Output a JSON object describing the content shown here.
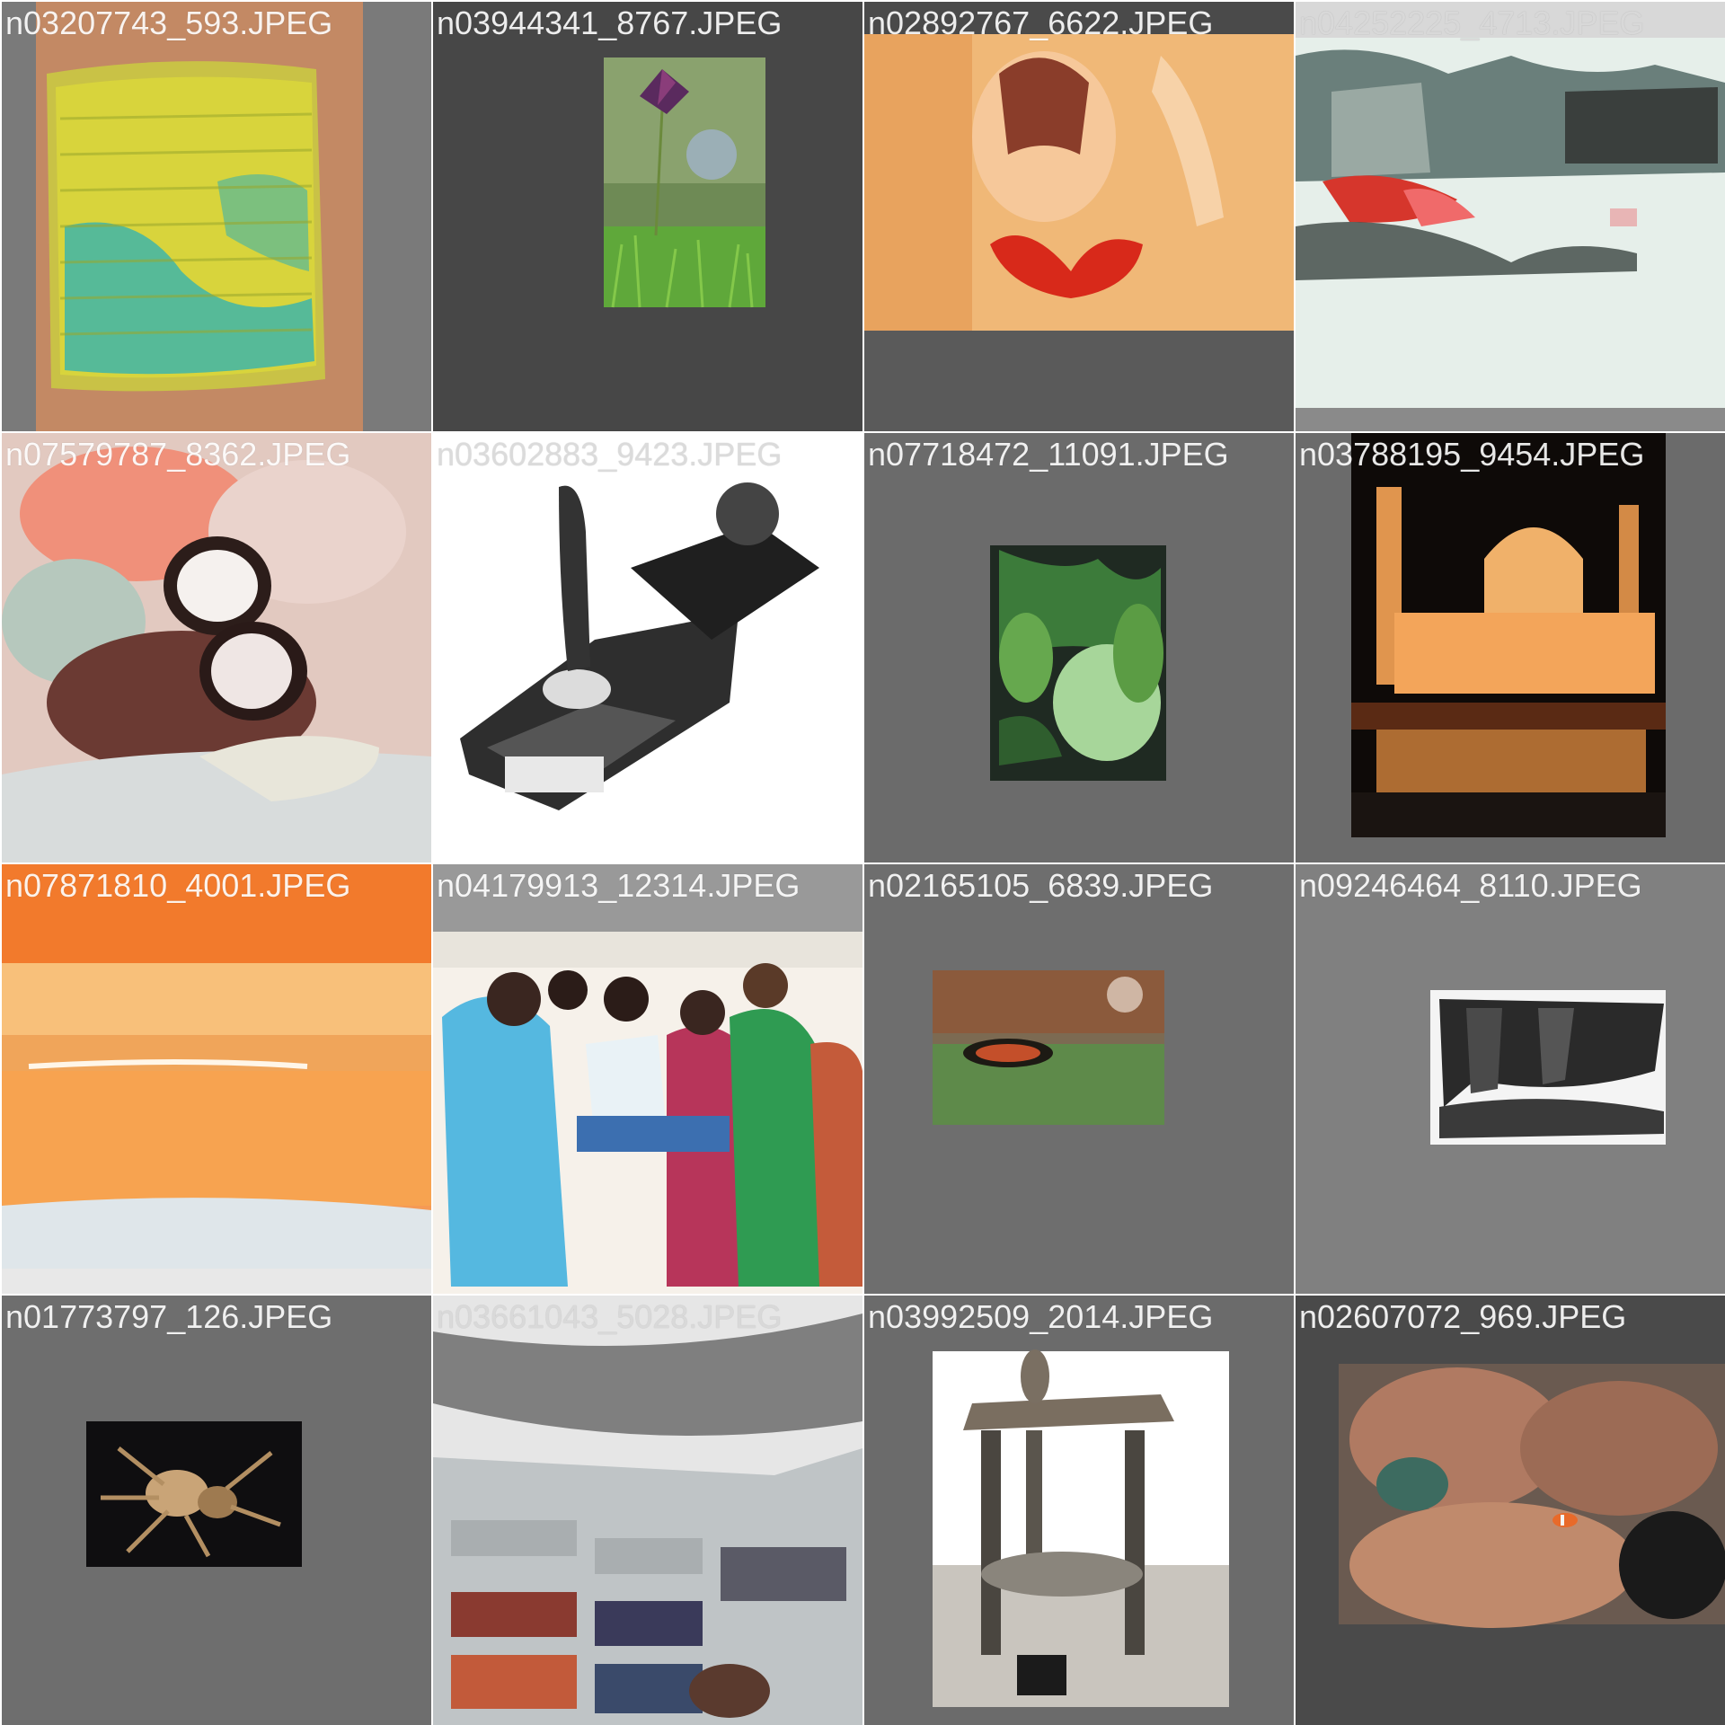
{
  "tiles": [
    {
      "label": "n03207743_593.JPEG",
      "subject": "knitted-dishcloth",
      "background": "#7a7a7a"
    },
    {
      "label": "n03944341_8767.JPEG",
      "subject": "pinwheel-flower",
      "background": "#474747"
    },
    {
      "label": "n02892767_6622.JPEG",
      "subject": "red-bikini-figure",
      "background": "#5a5a5a"
    },
    {
      "label": "n04252225_4713.JPEG",
      "subject": "snowplow-scene",
      "background": "#8a8a8a"
    },
    {
      "label": "n07579787_8362.JPEG",
      "subject": "plated-food",
      "background": "#f2e9e6"
    },
    {
      "label": "n03602883_9423.JPEG",
      "subject": "joystick-trophy",
      "background": "#ffffff"
    },
    {
      "label": "n07718472_11091.JPEG",
      "subject": "cucumber-plant",
      "background": "#6b6b6b"
    },
    {
      "label": "n03788195_9454.JPEG",
      "subject": "illuminated-mosque",
      "background": "#6b6b6b"
    },
    {
      "label": "n07871810_4001.JPEG",
      "subject": "baked-pastry",
      "background": "#e8e8e8"
    },
    {
      "label": "n04179913_12314.JPEG",
      "subject": "sewing-machine-ceremony",
      "background": "#999999"
    },
    {
      "label": "n02165105_6839.JPEG",
      "subject": "tiger-beetle",
      "background": "#6e6e6e"
    },
    {
      "label": "n09246464_8110.JPEG",
      "subject": "cliff-face",
      "background": "#808080"
    },
    {
      "label": "n01773797_126.JPEG",
      "subject": "garden-spider",
      "background": "#6e6e6e"
    },
    {
      "label": "n03661043_5028.JPEG",
      "subject": "library-bookshelves",
      "background": "#dcdcdc"
    },
    {
      "label": "n03992509_2014.JPEG",
      "subject": "potters-wheel",
      "background": "#6b6b6b"
    },
    {
      "label": "n02607072_969.JPEG",
      "subject": "clownfish-anemone",
      "background": "#4a4a4a"
    }
  ]
}
